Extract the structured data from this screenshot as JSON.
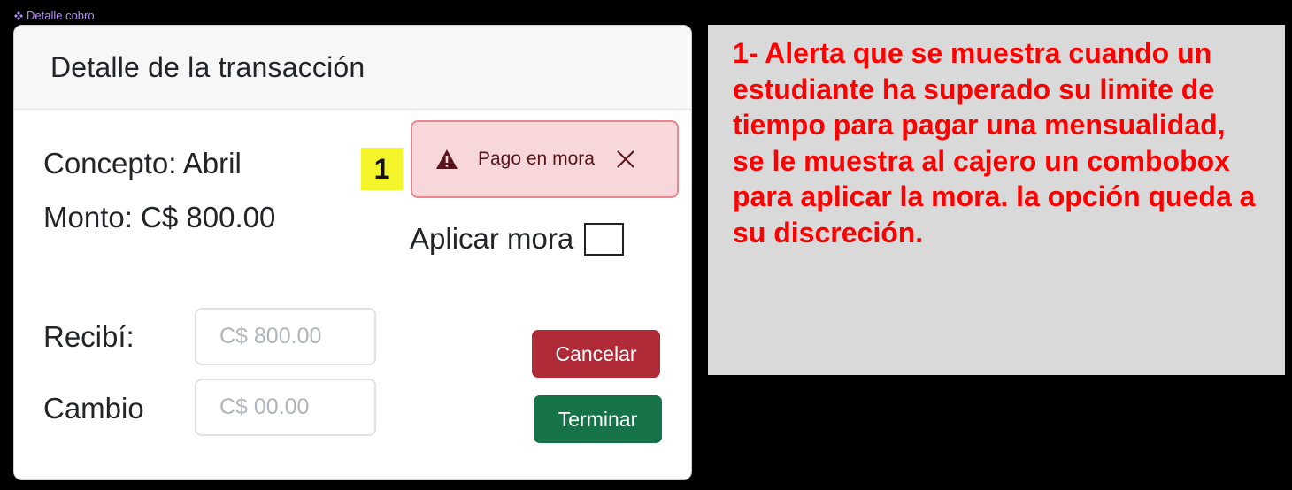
{
  "frame": {
    "label": "Detalle cobro",
    "icon": "component-icon"
  },
  "modal": {
    "title": "Detalle de la transacción",
    "concept": "Concepto: Abril",
    "amount": "Monto: C$ 800.00"
  },
  "badge": {
    "number": "1",
    "color": "#f4f42a"
  },
  "alert": {
    "text": "Pago en mora",
    "icon": "warning-icon",
    "close_icon": "close-icon",
    "background": "#f8d7da",
    "border": "#ea868f"
  },
  "late_fee": {
    "label": "Aplicar mora",
    "checked": false
  },
  "fields": {
    "received_label": "Recibí:",
    "received_placeholder": "C$ 800.00",
    "change_label": "Cambio",
    "change_placeholder": "C$ 00.00"
  },
  "buttons": {
    "cancel_label": "Cancelar",
    "cancel_color": "#b02a37",
    "finish_label": "Terminar",
    "finish_color": "#157347"
  },
  "note": {
    "text": "1- Alerta que se muestra cuando un estudiante ha superado su limite de tiempo para pagar una mensualidad, se le muestra al cajero un combobox para aplicar la mora. la opción queda a su discreción.",
    "color": "#ff0000",
    "background": "#d9d9d9"
  }
}
